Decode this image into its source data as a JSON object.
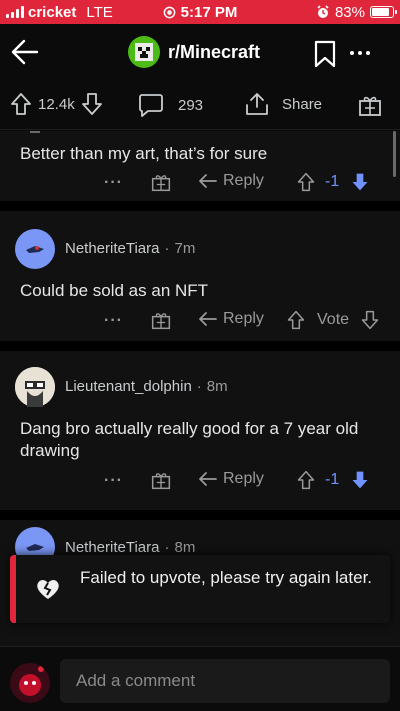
{
  "status_bar": {
    "carrier": "cricket",
    "network": "LTE",
    "time": "5:17 PM",
    "battery": "83%",
    "battery_level": 0.83
  },
  "nav": {
    "title": "r/Minecraft"
  },
  "post_actions": {
    "score": "12.4k",
    "comments": "293",
    "share_label": "Share"
  },
  "comments": [
    {
      "body": "Better than my art, that’s for sure",
      "reply_label": "Reply",
      "score": "-1",
      "vote_state": "downvoted"
    },
    {
      "username": "NetheriteTiara",
      "separator": "·",
      "time": "7m",
      "body": "Could be sold as an NFT",
      "reply_label": "Reply",
      "score": "Vote",
      "vote_state": "none"
    },
    {
      "username": "Lieutenant_dolphin",
      "separator": "·",
      "time": "8m",
      "body": "Dang bro actually really good for a 7 year old drawing",
      "reply_label": "Reply",
      "score": "-1",
      "vote_state": "downvoted"
    },
    {
      "username": "NetheriteTiara",
      "separator": "·",
      "time": "8m"
    }
  ],
  "toast": {
    "message": "Failed to upvote, please try again later."
  },
  "composer": {
    "placeholder": "Add a comment"
  },
  "colors": {
    "accent_red": "#e0263b",
    "downvote_blue": "#7193ff",
    "background": "#0b0b0b"
  }
}
